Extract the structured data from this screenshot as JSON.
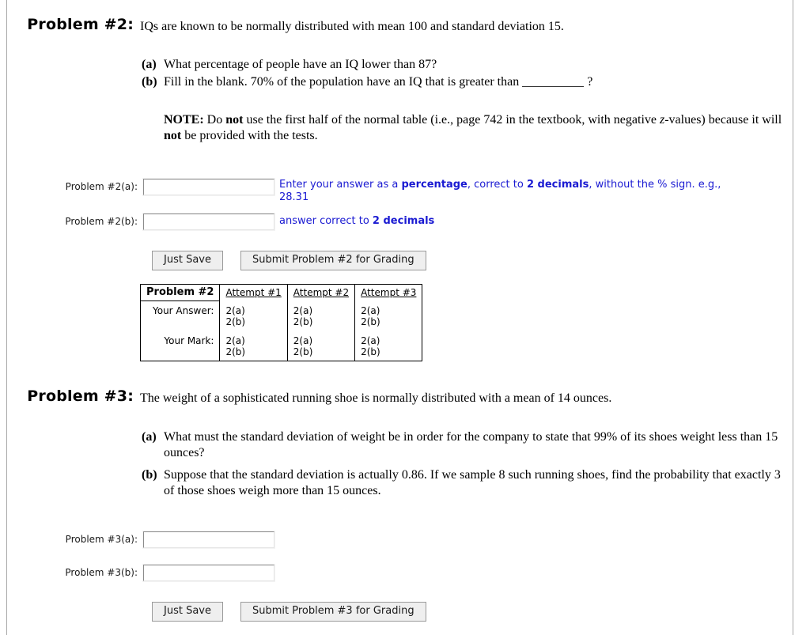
{
  "problems": [
    {
      "label": "Problem #2:",
      "stem": "IQs are known to be normally distributed with mean 100 and standard deviation 15.",
      "parts": [
        {
          "tag": "(a)",
          "text": "What percentage of people have an IQ lower than 87?"
        },
        {
          "tag": "(b)",
          "pre": "Fill in the blank. 70% of the population have an IQ that is greater than",
          "post": "?"
        }
      ],
      "note": {
        "heading": "NOTE:",
        "seg1": " Do ",
        "bold1": "not",
        "seg2": " use the first half of the normal table (i.e., page 742 in the textbook, with negative ",
        "italic1": "z",
        "seg3": "-values) because it will ",
        "bold2": "not",
        "seg4": " be provided with the tests."
      },
      "answers": [
        {
          "label": "Problem #2(a):",
          "value": "",
          "placeholder": "",
          "hint": {
            "seg1": "Enter your answer as a ",
            "bold1": "percentage",
            "seg2": ", correct to ",
            "bold2": "2 decimals",
            "seg3": ", without the % sign. e.g., 28.31"
          }
        },
        {
          "label": "Problem #2(b):",
          "value": "",
          "placeholder": "",
          "hint": {
            "seg1": "answer correct to ",
            "bold1": "2 decimals",
            "seg2": ""
          }
        }
      ],
      "buttons": {
        "save": "Just Save",
        "submit": "Submit Problem #2 for Grading"
      },
      "attempts_table": {
        "title": "Problem #2",
        "columns": [
          "Attempt #1",
          "Attempt #2",
          "Attempt #3"
        ],
        "rows": [
          {
            "label": "Your Answer:",
            "cells": [
              [
                "2(a)",
                "2(b)"
              ],
              [
                "2(a)",
                "2(b)"
              ],
              [
                "2(a)",
                "2(b)"
              ]
            ]
          },
          {
            "label": "Your Mark:",
            "cells": [
              [
                "2(a)",
                "2(b)"
              ],
              [
                "2(a)",
                "2(b)"
              ],
              [
                "2(a)",
                "2(b)"
              ]
            ]
          }
        ]
      }
    },
    {
      "label": "Problem #3:",
      "stem": "The weight of a sophisticated running shoe is normally distributed with a mean of 14 ounces.",
      "parts": [
        {
          "tag": "(a)",
          "text": "What must the standard deviation of weight be in order for the company to state that 99% of its shoes weight less than 15 ounces?"
        },
        {
          "tag": "(b)",
          "text": "Suppose that the standard deviation is actually 0.86. If we sample 8 such running shoes, find the probability that exactly 3 of those shoes weigh more than 15 ounces."
        }
      ],
      "answers": [
        {
          "label": "Problem #3(a):",
          "value": "",
          "placeholder": ""
        },
        {
          "label": "Problem #3(b):",
          "value": "",
          "placeholder": ""
        }
      ],
      "buttons": {
        "save": "Just Save",
        "submit": "Submit Problem #3 for Grading"
      }
    }
  ],
  "colors": {
    "hint_blue": "#1a1ad2",
    "button_face": "#efefef",
    "frame_rule": "#a9a9a9"
  }
}
